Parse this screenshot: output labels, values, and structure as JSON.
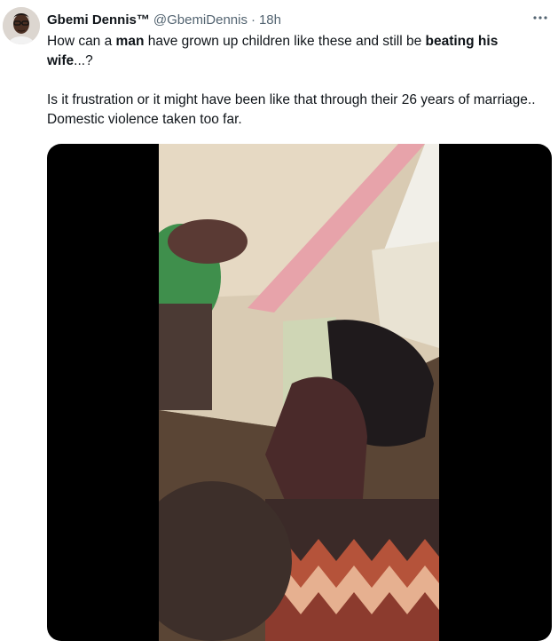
{
  "tweet": {
    "author": {
      "display_name": "Gbemi Dennis™",
      "handle": "@GbemiDennis",
      "separator": "·",
      "time": "18h"
    },
    "more_icon": "more-horizontal-icon",
    "paragraph1": {
      "t1": "How can a ",
      "b1": "man",
      "t2": " have grown up children like these and still be ",
      "b2": "beating his wife",
      "t3": "...?"
    },
    "paragraph2": "Is it frustration or it might have been like that through their 26 years of marriage.. Domestic violence taken too far.",
    "media": {
      "type": "video"
    }
  },
  "colors": {
    "text": "#0f1419",
    "secondary": "#536471",
    "background": "#ffffff"
  }
}
